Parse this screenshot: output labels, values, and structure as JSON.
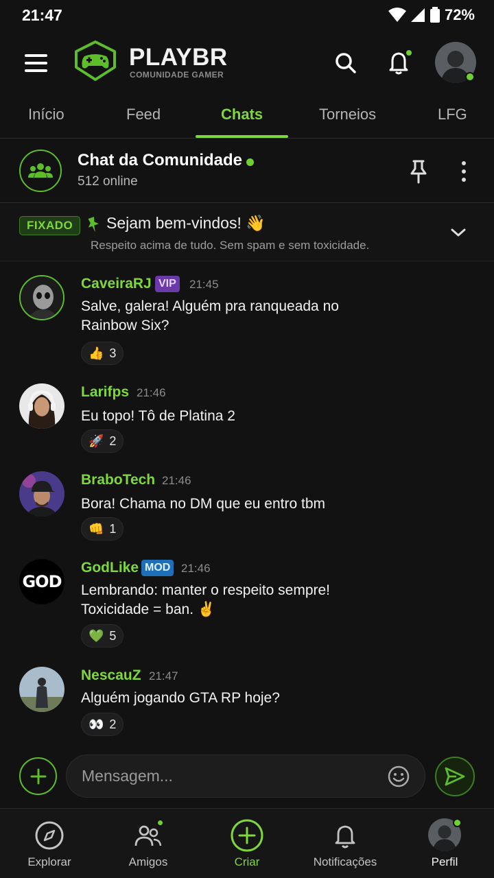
{
  "status_bar": {
    "time": "21:47",
    "battery": "72%"
  },
  "app": {
    "logo_title": "PLAYBR",
    "logo_subtitle": "COMUNIDADE GAMER"
  },
  "tabs": [
    {
      "label": "Início",
      "active": false
    },
    {
      "label": "Feed",
      "active": false
    },
    {
      "label": "Chats",
      "active": true
    },
    {
      "label": "Torneios",
      "active": false
    },
    {
      "label": "LFG",
      "active": false
    }
  ],
  "chat": {
    "title": "Chat da Comunidade",
    "online": "512 online"
  },
  "pinned": {
    "badge": "FIXADO",
    "title": "Sejam bem-vindos! 👋",
    "text": "Respeito acima de tudo. Sem spam e sem toxicidade."
  },
  "messages": [
    {
      "user": "CaveiraRJ",
      "badge": "VIP",
      "time": "21:45",
      "text": "Salve, galera! Alguém pra ranqueada no Rainbow Six?",
      "reaction": {
        "emoji": "👍",
        "count": "3"
      }
    },
    {
      "user": "Larifps",
      "badge": "",
      "time": "21:46",
      "text": "Eu topo! Tô de Platina 2",
      "reaction": {
        "emoji": "🚀",
        "count": "2"
      }
    },
    {
      "user": "BraboTech",
      "badge": "",
      "time": "21:46",
      "text": "Bora! Chama no DM que eu entro tbm",
      "reaction": {
        "emoji": "👊",
        "count": "1"
      }
    },
    {
      "user": "GodLike",
      "badge": "MOD",
      "time": "21:46",
      "text": "Lembrando: manter o respeito sempre! Toxicidade = ban. ✌️",
      "reaction": {
        "emoji": "💚",
        "count": "5"
      },
      "avatar_text": "GOD"
    },
    {
      "user": "NescauZ",
      "badge": "",
      "time": "21:47",
      "text": "Alguém jogando GTA RP hoje?",
      "reaction": {
        "emoji": "👀",
        "count": "2"
      }
    }
  ],
  "composer": {
    "placeholder": "Mensagem..."
  },
  "bottom_nav": [
    {
      "label": "Explorar",
      "icon": "compass-icon"
    },
    {
      "label": "Amigos",
      "icon": "friends-icon"
    },
    {
      "label": "Criar",
      "icon": "plus-circle-icon",
      "active": true
    },
    {
      "label": "Notificações",
      "icon": "bell-icon"
    },
    {
      "label": "Perfil",
      "icon": "avatar"
    }
  ],
  "colors": {
    "accent": "#7ed83a",
    "background": "#121212",
    "vip": "#6a3aa8",
    "mod": "#1f6fb8"
  }
}
